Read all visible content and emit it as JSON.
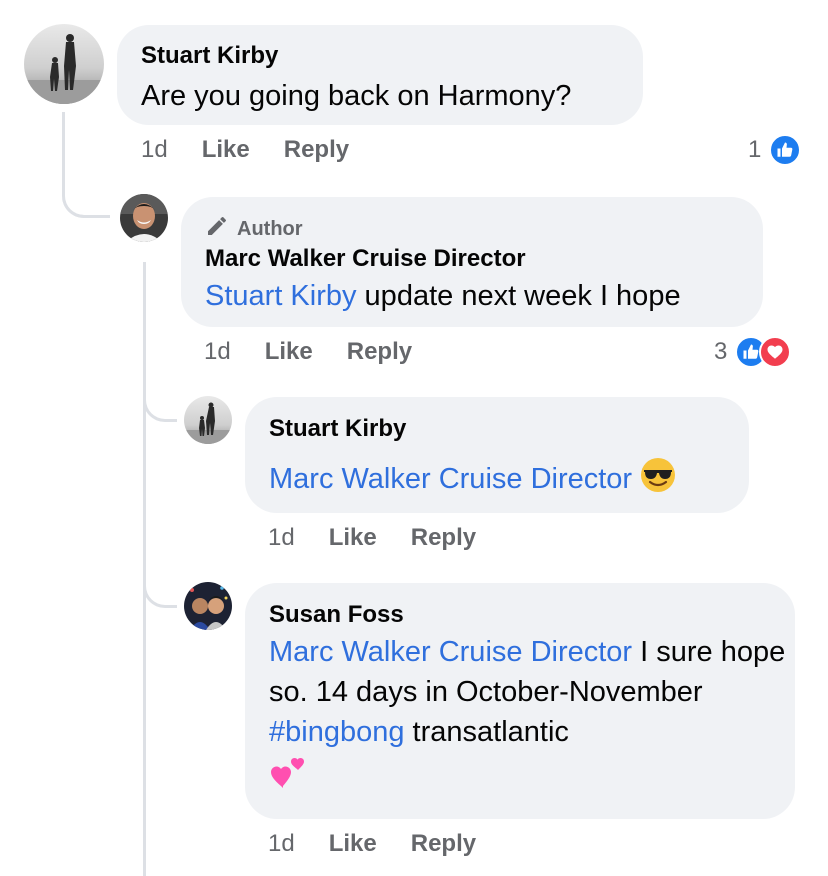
{
  "comments": [
    {
      "author": "Stuart Kirby",
      "text": "Are you going back on Harmony?",
      "time": "1d",
      "like_label": "Like",
      "reply_label": "Reply",
      "reaction_count": "1",
      "reactions": [
        "like-icon"
      ]
    },
    {
      "badge": "Author",
      "author": "Marc Walker Cruise Director",
      "mention": "Stuart Kirby",
      "text": " update next week I hope",
      "time": "1d",
      "like_label": "Like",
      "reply_label": "Reply",
      "reaction_count": "3",
      "reactions": [
        "like-icon",
        "love-icon"
      ]
    },
    {
      "author": "Stuart Kirby",
      "mention": "Marc Walker Cruise Director",
      "text": " ",
      "emoji": "smiling-face-with-sunglasses",
      "time": "1d",
      "like_label": "Like",
      "reply_label": "Reply"
    },
    {
      "author": "Susan Foss",
      "mention": "Marc Walker Cruise Director",
      "text": " I sure hope so. 14 days in October-November ",
      "hashtag": "#bingbong",
      "text_after": " transatlantic",
      "emoji": "two-hearts",
      "time": "1d",
      "like_label": "Like",
      "reply_label": "Reply"
    }
  ],
  "colors": {
    "link": "#2f6fdd",
    "bubble": "#f0f2f5",
    "meta": "#65676b",
    "like": "#1d7df0",
    "love": "#f23e4f"
  }
}
